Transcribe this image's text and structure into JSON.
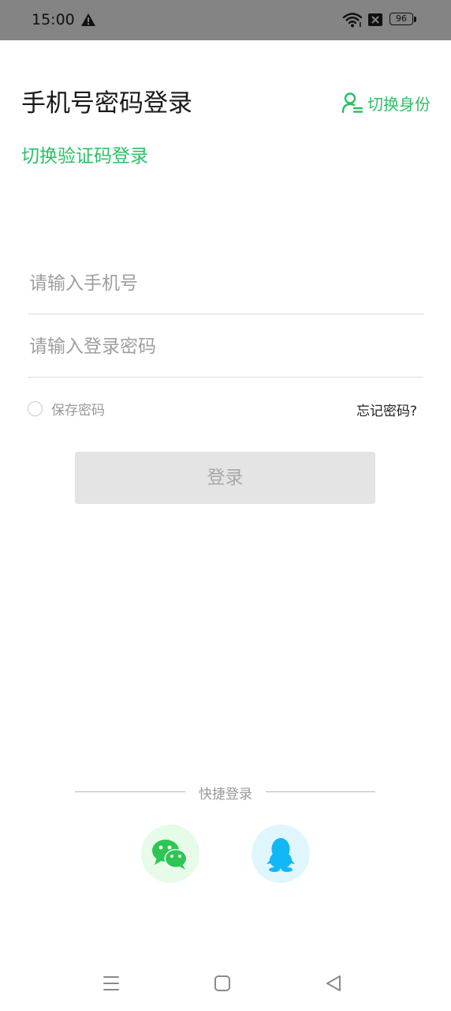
{
  "status_bar": {
    "time": "15:00",
    "battery": "96",
    "icons": [
      "warning-icon",
      "wifi-icon",
      "no-sim-icon",
      "battery-icon"
    ]
  },
  "header": {
    "title": "手机号密码登录",
    "switch_identity": "切换身份",
    "switch_code_login": "切换验证码登录"
  },
  "form": {
    "phone_placeholder": "请输入手机号",
    "password_placeholder": "请输入登录密码",
    "remember_password": "保存密码",
    "forgot_password": "忘记密码?",
    "login_button": "登录"
  },
  "quick_login": {
    "label": "快捷登录",
    "providers": [
      "wechat-icon",
      "qq-icon"
    ]
  },
  "nav_bar": {
    "icons": [
      "menu-icon",
      "home-icon",
      "back-icon"
    ]
  },
  "colors": {
    "accent": "#2cc065",
    "status_bar_bg": "#848484",
    "button_bg": "#e4e4e4",
    "wechat": "#2dc653",
    "qq": "#12b7f5"
  }
}
